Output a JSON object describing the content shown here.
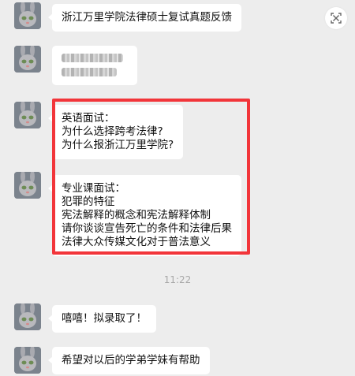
{
  "messages": [
    {
      "lines": [
        "浙江万里学院法律硕士复试真题反馈"
      ]
    },
    {
      "redacted": true
    },
    {
      "lines": [
        "英语面试：",
        "为什么选择跨考法律?",
        "为什么报浙江万里学院?"
      ]
    },
    {
      "lines": [
        "专业课面试：",
        "犯罪的特征",
        "宪法解释的概念和宪法解释体制",
        "请你谈谈宣告死亡的条件和法律后果",
        "法律大众传媒文化对于普法意义"
      ]
    },
    {
      "lines": [
        "嘻嘻！拟录取了！"
      ]
    },
    {
      "lines": [
        "希望对以后的学弟学妹有帮助"
      ]
    }
  ],
  "timestamp": "11:22",
  "icons": {
    "avatar": "bunny-avatar-icon",
    "corner": "scan-icon"
  },
  "colors": {
    "background": "#ededed",
    "bubble": "#ffffff",
    "highlight_border": "#f2353a",
    "timestamp": "#a8a8a8"
  }
}
